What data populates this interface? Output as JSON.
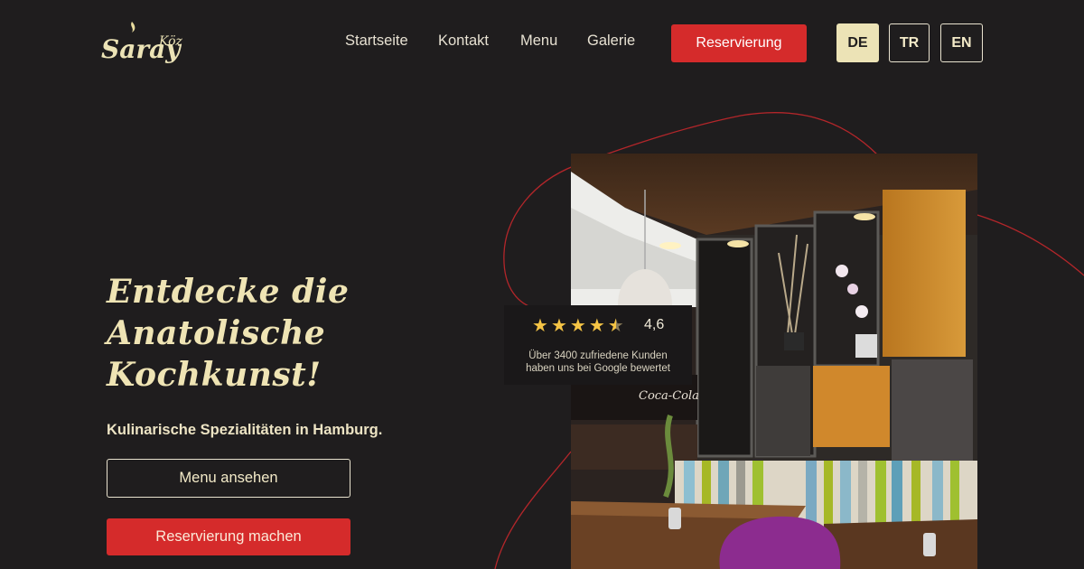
{
  "brand": {
    "logo_text_main": "Saray",
    "logo_text_sub": "Köz",
    "accent": "#d52b2b",
    "cream": "#ece3b6"
  },
  "nav": {
    "items": [
      {
        "label": "Startseite"
      },
      {
        "label": "Kontakt"
      },
      {
        "label": "Menu"
      },
      {
        "label": "Galerie"
      }
    ],
    "reservation_label": "Reservierung"
  },
  "languages": [
    {
      "label": "DE",
      "active": true
    },
    {
      "label": "TR",
      "active": false
    },
    {
      "label": "EN",
      "active": false
    }
  ],
  "hero": {
    "title_lines": [
      "Entdecke die",
      "Anatolische",
      "Kochkunst!"
    ],
    "subtitle": "Kulinarische Spezialitäten in Hamburg.",
    "menu_button": "Menu ansehen",
    "reserve_button": "Reservierung machen"
  },
  "rating": {
    "value": "4,6",
    "stars": 4.5,
    "text_line1": "Über 3400 zufriedene Kunden",
    "text_line2": "haben uns bei Google bewertet"
  },
  "photo": {
    "sign_text": "Coca-Cola"
  }
}
